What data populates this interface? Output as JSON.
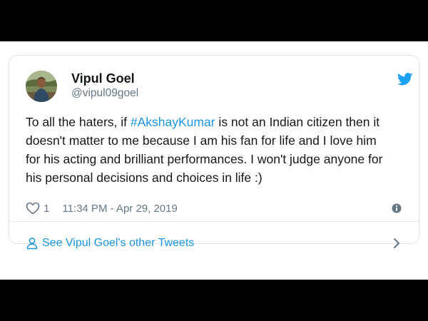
{
  "tweet": {
    "author_name": "Vipul Goel",
    "author_handle": "@vipul09goel",
    "text_lines": [
      {
        "before": "To all the haters, if ",
        "hashtag": "#AkshayKumar",
        "after": " is not an Indian citizen then it"
      },
      {
        "text": "doesn't matter to me because I am his fan for life and I love him"
      },
      {
        "text": "for his acting and brilliant performances. I won't judge anyone for"
      },
      {
        "text": "his personal decisions and choices in life :)"
      }
    ],
    "like_count": "1",
    "timestamp": "11:34 PM - Apr 29, 2019",
    "footer_link": "See Vipul Goel's other Tweets"
  },
  "icons": {
    "brand": "twitter-bird-icon",
    "like": "heart-icon",
    "info": "info-icon",
    "profile": "person-icon",
    "more": "chevron-right-icon"
  },
  "colors": {
    "link": "#1b95e0",
    "text": "#14171a",
    "muted": "#657786",
    "border": "#dfe5ea",
    "letterbox": "#000000"
  }
}
